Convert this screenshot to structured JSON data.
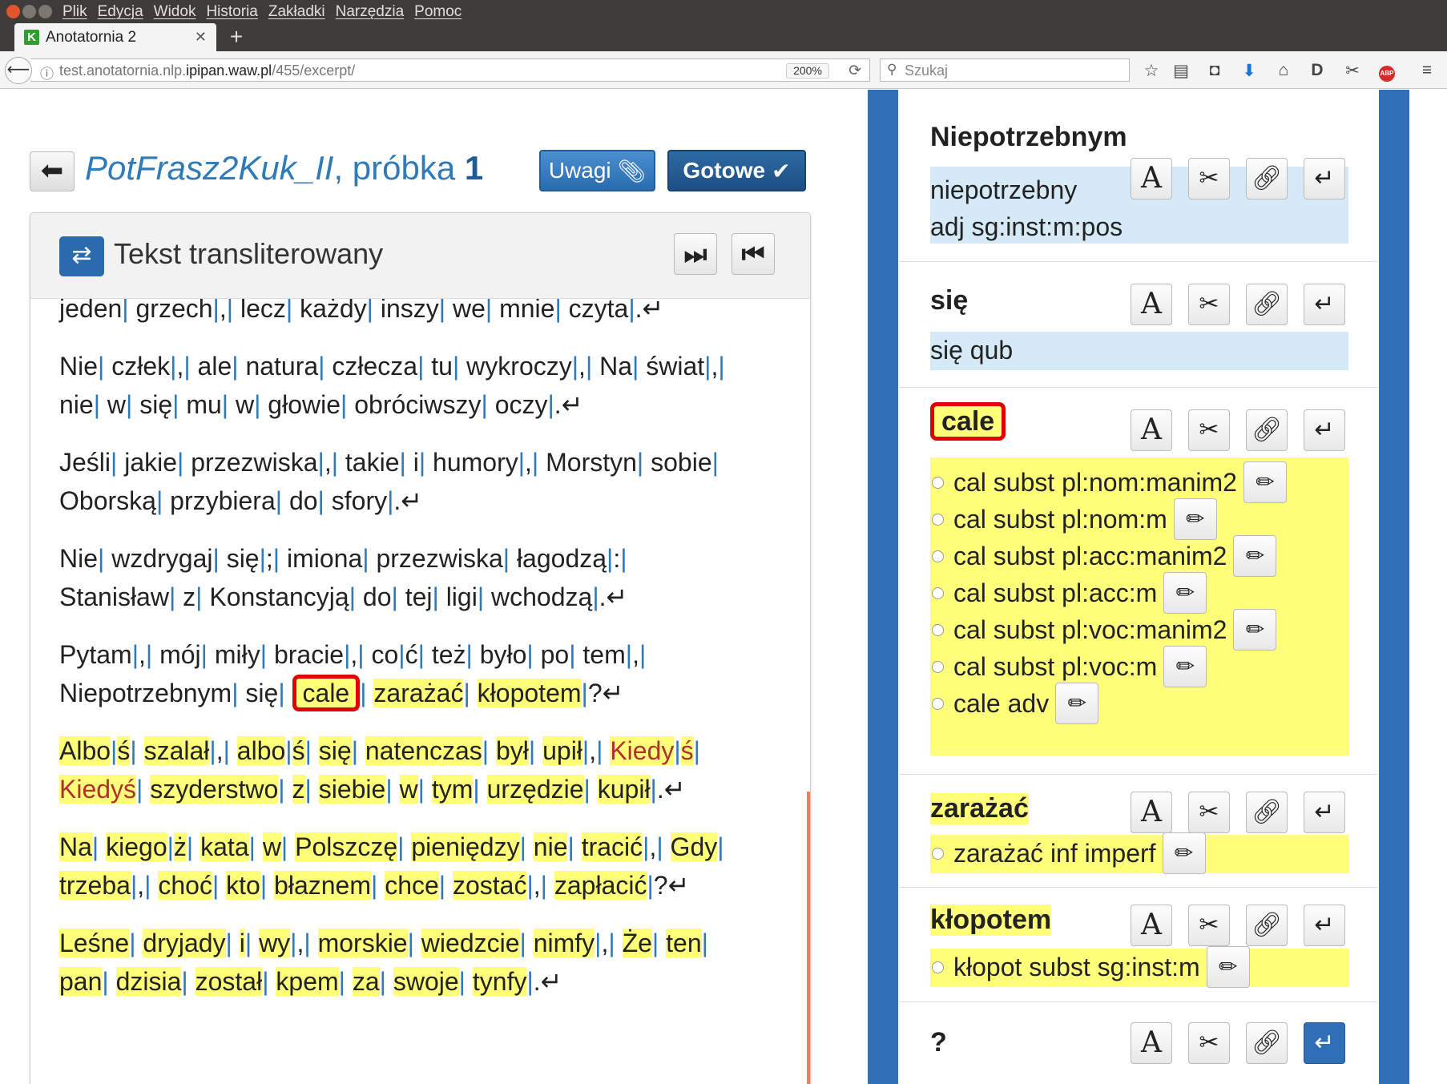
{
  "menubar": {
    "items": [
      "Plik",
      "Edycja",
      "Widok",
      "Historia",
      "Zakładki",
      "Narzędzia",
      "Pomoc"
    ]
  },
  "tab": {
    "title": "Anotatornia 2",
    "favicon": "K"
  },
  "url": {
    "prefix": "test.anotatornia.nlp.",
    "domain": "ipipan.waw.pl",
    "path": "/455/excerpt/",
    "zoom": "200%"
  },
  "search": {
    "placeholder": "Szukaj"
  },
  "header": {
    "title_italic": "PotFrasz2Kuk_II",
    "title_mid": ", próbka ",
    "title_num": "1",
    "uwagi": "Uwagi",
    "gotowe": "Gotowe"
  },
  "panel": {
    "title": "Tekst transliterowany"
  },
  "tokens": [
    {
      "name": "Niepotrzebnym",
      "interps": [
        "niepotrzebny",
        "adj sg:inst:m:pos"
      ]
    },
    {
      "name": "się",
      "interps": [
        "się qub"
      ]
    },
    {
      "name": "cale",
      "interps": [
        "cal subst pl:nom:manim2",
        "cal subst pl:nom:m",
        "cal subst pl:acc:manim2",
        "cal subst pl:acc:m",
        "cal subst pl:voc:manim2",
        "cal subst pl:voc:m",
        "cale adv"
      ]
    },
    {
      "name": "zarażać",
      "interps": [
        "zarażać inf imperf"
      ]
    },
    {
      "name": "kłopotem",
      "interps": [
        "kłopot subst sg:inst:m"
      ]
    },
    {
      "name": "?",
      "interps": []
    }
  ],
  "colors": {
    "accent": "#2f6fb5",
    "highlight": "#ffff7a",
    "selected": "#e00000"
  }
}
